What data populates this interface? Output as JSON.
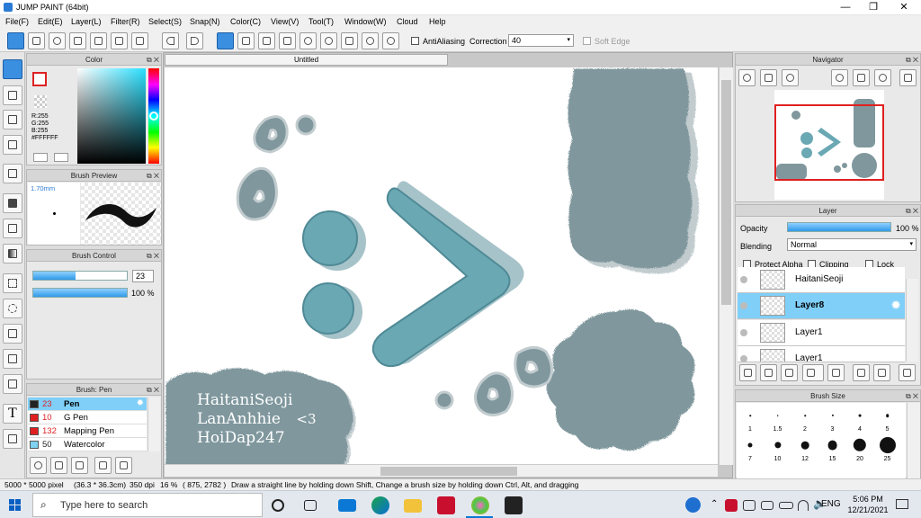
{
  "window": {
    "title": "JUMP PAINT (64bit)",
    "min": "—",
    "max": "❐",
    "close": "✕"
  },
  "menu": [
    "File(F)",
    "Edit(E)",
    "Layer(L)",
    "Filter(R)",
    "Select(S)",
    "Snap(N)",
    "Color(C)",
    "View(V)",
    "Tool(T)",
    "Window(W)",
    "Cloud",
    "Help"
  ],
  "toolbar": {
    "antialias_label": "AntiAliasing",
    "correction_label": "Correction",
    "correction_value": "40",
    "softedge_label": "Soft Edge"
  },
  "color_panel": {
    "title": "Color",
    "r": "R:255",
    "g": "G:255",
    "b": "B:255",
    "hex": "#FFFFFF"
  },
  "brush_preview": {
    "title": "Brush Preview",
    "size": "1.70mm"
  },
  "brush_control": {
    "title": "Brush Control",
    "size_value": "23",
    "opacity_value": "100 %",
    "size_fraction": 0.45,
    "opacity_fraction": 1.0
  },
  "brush_list": {
    "title": "Brush: Pen",
    "items": [
      {
        "size": "23",
        "name": "Pen",
        "color": "#222222",
        "bold": true
      },
      {
        "size": "10",
        "name": "G Pen",
        "color": "#e02020"
      },
      {
        "size": "132",
        "name": "Mapping Pen",
        "color": "#e02020"
      },
      {
        "size": "50",
        "name": "Watercolor",
        "color": "#7fd3f0"
      }
    ]
  },
  "canvas": {
    "tab": "Untitled",
    "signature": [
      "HaitaniSeoji",
      "LanAnhhie",
      "HoiDap247"
    ],
    "heart": "<3"
  },
  "navigator": {
    "title": "Navigator"
  },
  "layer_panel": {
    "title": "Layer",
    "opacity_label": "Opacity",
    "opacity_value": "100 %",
    "blending_label": "Blending",
    "blending_value": "Normal",
    "protect_alpha": "Protect Alpha",
    "clipping": "Clipping",
    "lock": "Lock",
    "layers": [
      "HaitaniSeoji",
      "Layer8",
      "Layer1",
      "Layer1"
    ]
  },
  "brush_size": {
    "title": "Brush Size",
    "sizes": [
      "1",
      "1.5",
      "2",
      "3",
      "4",
      "5",
      "7",
      "10",
      "12",
      "15",
      "20",
      "25"
    ]
  },
  "status": {
    "dims": "5000 * 5000 pixel",
    "cm": "(36.3 * 36.3cm)",
    "dpi": "350 dpi",
    "zoom": "16 %",
    "coords": "( 875, 2782 )",
    "hint": "Draw a straight line by holding down Shift, Change a brush size by holding down Ctrl, Alt, and dragging"
  },
  "taskbar": {
    "search_placeholder": "Type here to search",
    "lang": "ENG",
    "time": "5:06 PM",
    "date": "12/21/2021"
  },
  "colors": {
    "accent": "#3b8fe0",
    "shape": "#6aa8b4",
    "cloud": "#7f979d"
  }
}
